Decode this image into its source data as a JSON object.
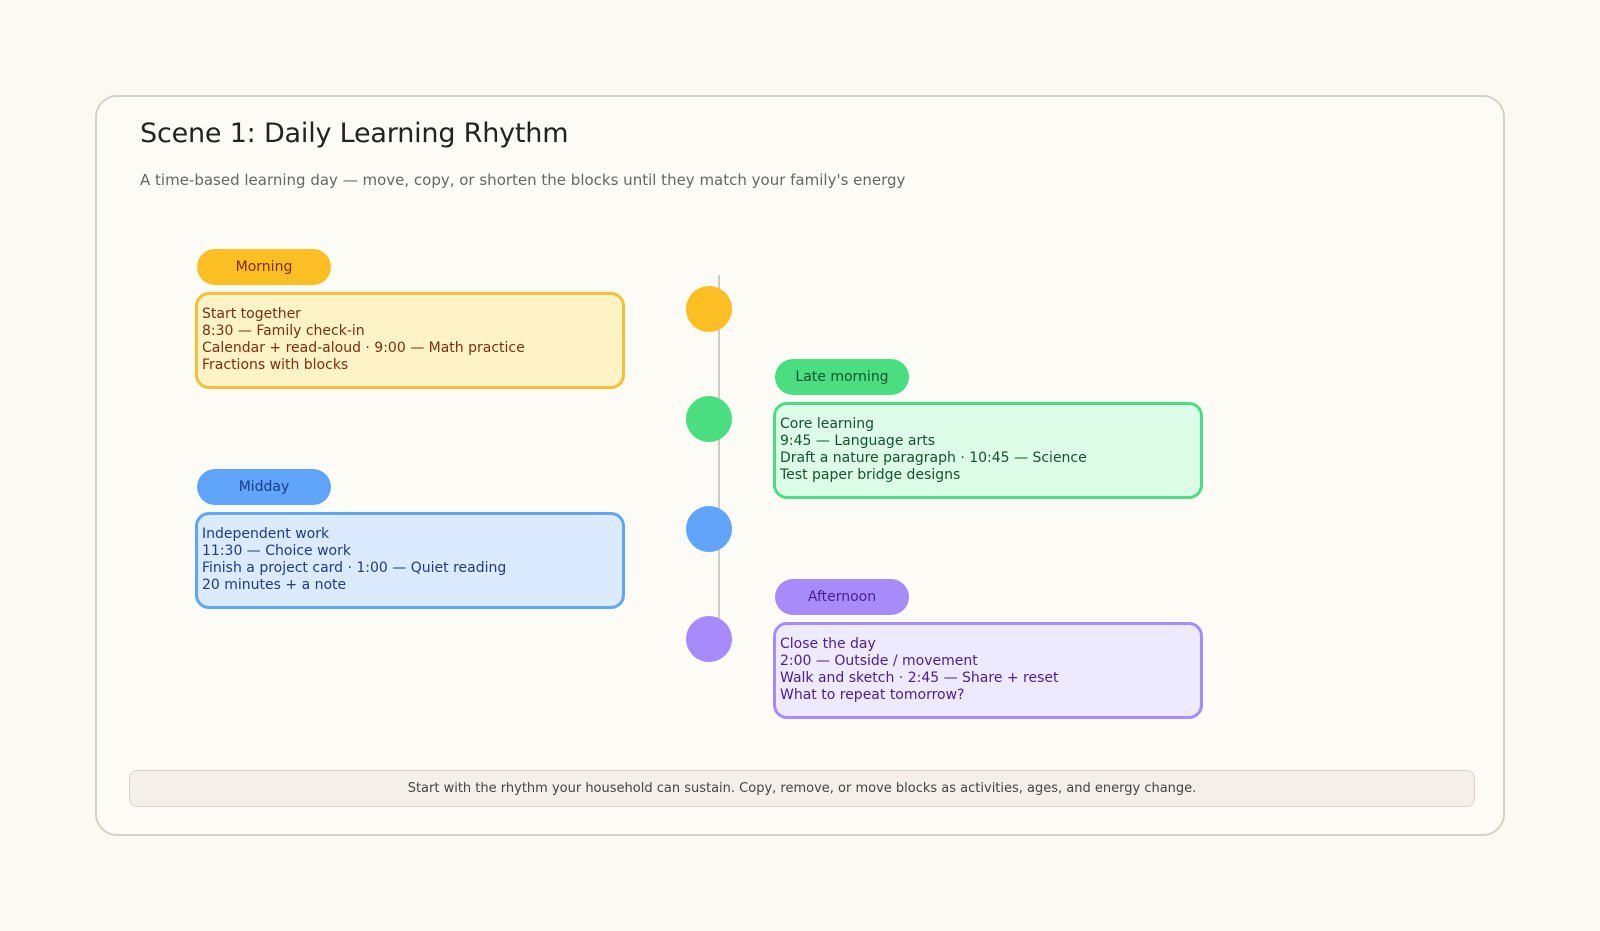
{
  "title": "Scene 1: Daily Learning Rhythm",
  "subtitle": "A time-based learning day — move, copy, or shorten the blocks until they match your family's energy",
  "blocks": [
    {
      "label": "Morning",
      "lines": [
        "Start together",
        "8:30 — Family check-in",
        "Calendar + read-aloud  ·  9:00 — Math practice",
        "Fractions with blocks"
      ],
      "colors": {
        "dot": "#fbbf24",
        "pill_bg": "#fbbf24",
        "pill_text": "#7c2d12",
        "card_bg": "#fef3c7",
        "card_border": "#f4c03a",
        "card_text": "#7c2d12"
      }
    },
    {
      "label": "Late morning",
      "lines": [
        "Core learning",
        "9:45 — Language arts",
        "Draft a nature paragraph  ·  10:45 — Science",
        "Test paper bridge designs"
      ],
      "colors": {
        "dot": "#4ade80",
        "pill_bg": "#4ade80",
        "pill_text": "#14532d",
        "card_bg": "#dcfce7",
        "card_border": "#4ade80",
        "card_text": "#14532d"
      }
    },
    {
      "label": "Midday",
      "lines": [
        "Independent work",
        "11:30 — Choice work",
        "Finish a project card  ·  1:00 — Quiet reading",
        "20 minutes + a note"
      ],
      "colors": {
        "dot": "#60a5fa",
        "pill_bg": "#60a5fa",
        "pill_text": "#1e3a8a",
        "card_bg": "#dbeafe",
        "card_border": "#60a5fa",
        "card_text": "#1e3a8a"
      }
    },
    {
      "label": "Afternoon",
      "lines": [
        "Close the day",
        "2:00 — Outside / movement",
        "Walk and sketch  ·  2:45 — Share + reset",
        "What to repeat tomorrow?"
      ],
      "colors": {
        "dot": "#a78bfa",
        "pill_bg": "#a78bfa",
        "pill_text": "#4c1d95",
        "card_bg": "#ede9fe",
        "card_border": "#a78bfa",
        "card_text": "#4c1d95"
      }
    }
  ],
  "footer": "Start with the rhythm your household can sustain. Copy, remove, or move blocks as activities, ages, and energy change."
}
